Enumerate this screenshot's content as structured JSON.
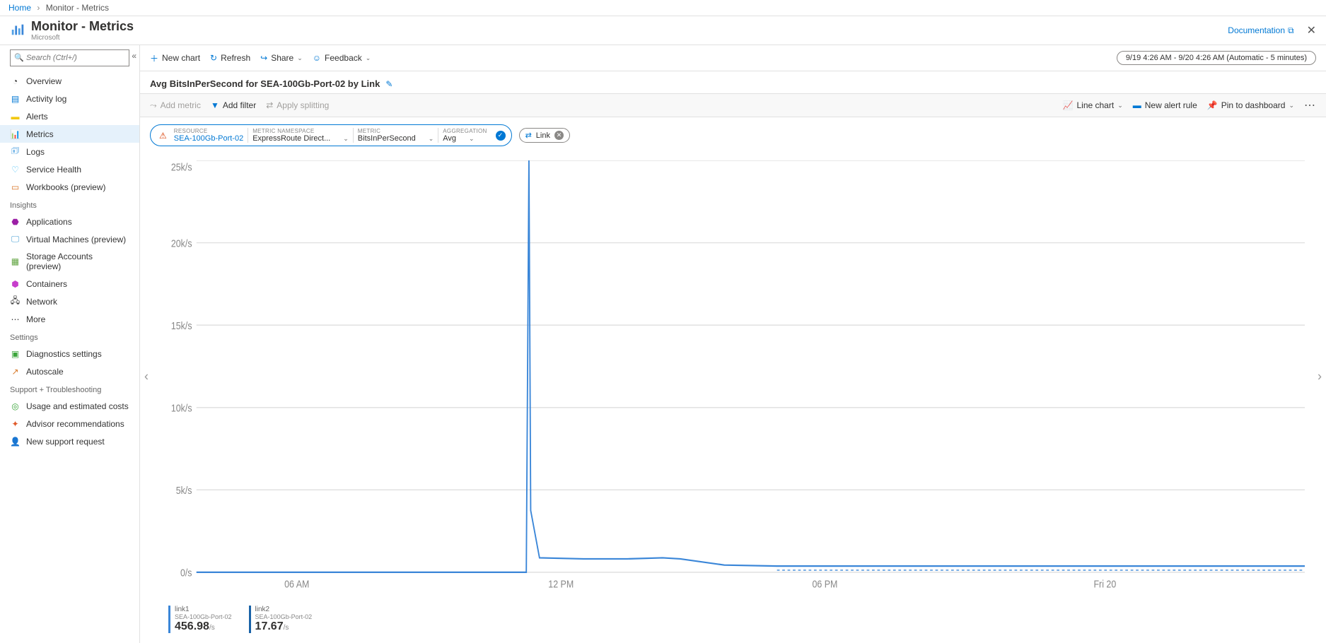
{
  "breadcrumb": {
    "home": "Home",
    "section": "Monitor - Metrics"
  },
  "header": {
    "title": "Monitor - Metrics",
    "subtitle": "Microsoft",
    "doc": "Documentation"
  },
  "search": {
    "placeholder": "Search (Ctrl+/)"
  },
  "sidebar": {
    "items": [
      {
        "label": "Overview"
      },
      {
        "label": "Activity log"
      },
      {
        "label": "Alerts"
      },
      {
        "label": "Metrics"
      },
      {
        "label": "Logs"
      },
      {
        "label": "Service Health"
      },
      {
        "label": "Workbooks (preview)"
      }
    ],
    "insights_label": "Insights",
    "insights": [
      {
        "label": "Applications"
      },
      {
        "label": "Virtual Machines (preview)"
      },
      {
        "label": "Storage Accounts (preview)"
      },
      {
        "label": "Containers"
      },
      {
        "label": "Network"
      },
      {
        "label": "More"
      }
    ],
    "settings_label": "Settings",
    "settings": [
      {
        "label": "Diagnostics settings"
      },
      {
        "label": "Autoscale"
      }
    ],
    "support_label": "Support + Troubleshooting",
    "support": [
      {
        "label": "Usage and estimated costs"
      },
      {
        "label": "Advisor recommendations"
      },
      {
        "label": "New support request"
      }
    ]
  },
  "toolbar": {
    "new_chart": "New chart",
    "refresh": "Refresh",
    "share": "Share",
    "feedback": "Feedback",
    "time_range": "9/19 4:26 AM - 9/20 4:26 AM (Automatic - 5 minutes)"
  },
  "chart_title": "Avg BitsInPerSecond for SEA-100Gb-Port-02 by Link",
  "filterbar": {
    "add_metric": "Add metric",
    "add_filter": "Add filter",
    "apply_splitting": "Apply splitting",
    "line_chart": "Line chart",
    "new_alert": "New alert rule",
    "pin": "Pin to dashboard"
  },
  "query": {
    "resource_label": "RESOURCE",
    "resource": "SEA-100Gb-Port-02",
    "ns_label": "METRIC NAMESPACE",
    "ns": "ExpressRoute Direct...",
    "metric_label": "METRIC",
    "metric": "BitsInPerSecond",
    "agg_label": "AGGREGATION",
    "agg": "Avg",
    "link_pill": "Link"
  },
  "chart_data": {
    "type": "line",
    "title": "Avg BitsInPerSecond for SEA-100Gb-Port-02 by Link",
    "xlabel": "",
    "ylabel": "",
    "y_ticks": [
      "0/s",
      "5k/s",
      "10k/s",
      "15k/s",
      "20k/s",
      "25k/s"
    ],
    "x_ticks": [
      "06 AM",
      "12 PM",
      "06 PM",
      "Fri 20"
    ],
    "ylim": [
      0,
      25000
    ],
    "series": [
      {
        "name": "link1",
        "resource": "SEA-100Gb-Port-02",
        "x": [
          0,
          1,
          2,
          3,
          4,
          5,
          6,
          7,
          8,
          9,
          10,
          11,
          11.1,
          11.5,
          12,
          13,
          14,
          15,
          16,
          17,
          18,
          19,
          20,
          21,
          22,
          23
        ],
        "values": [
          0,
          0,
          0,
          0,
          0,
          0,
          0,
          0,
          0,
          0,
          0,
          0,
          25000,
          4000,
          900,
          850,
          850,
          900,
          800,
          450,
          450,
          450,
          450,
          450,
          450,
          450
        ]
      },
      {
        "name": "link2",
        "resource": "SEA-100Gb-Port-02",
        "dashed_after_x": 18,
        "x": [
          0,
          6,
          12,
          18,
          24
        ],
        "values": [
          0,
          0,
          0,
          0,
          0
        ]
      }
    ]
  },
  "legend": {
    "items": [
      {
        "name": "link1",
        "sub": "SEA-100Gb-Port-02",
        "value": "456.98",
        "unit": "/s"
      },
      {
        "name": "link2",
        "sub": "SEA-100Gb-Port-02",
        "value": "17.67",
        "unit": "/s"
      }
    ]
  }
}
